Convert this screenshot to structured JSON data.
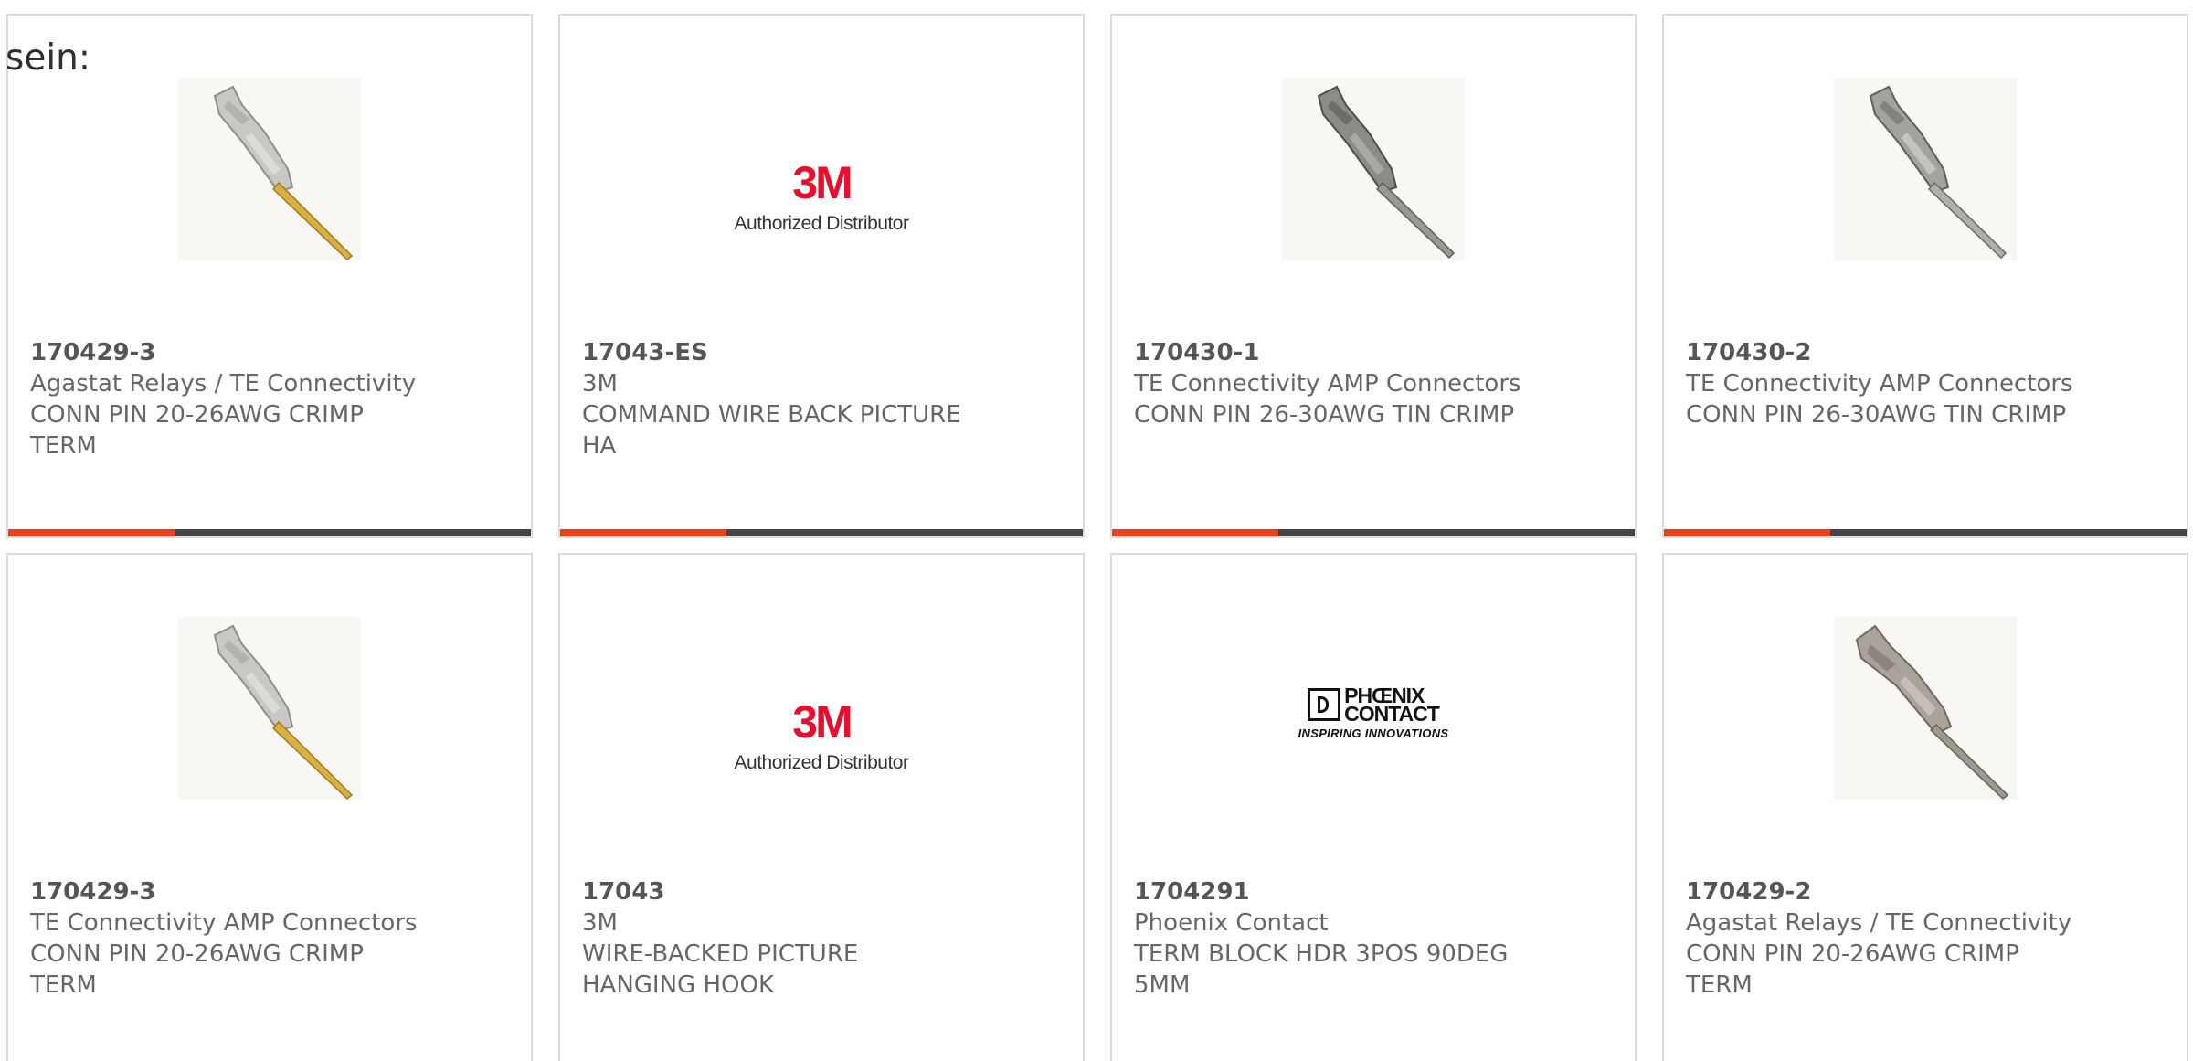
{
  "intro": {
    "text": "sein:"
  },
  "cards": [
    {
      "part_number": "170429-3",
      "manufacturer": "Agastat Relays / TE Connectivity",
      "description_line1": "CONN PIN 20-26AWG CRIMP",
      "description_line2": "TERM",
      "image": "gold-crimp-pin-image"
    },
    {
      "part_number": "17043-ES",
      "manufacturer": "3M",
      "description_line1": "COMMAND WIRE BACK PICTURE",
      "description_line2": "HA",
      "image": "3m-logo",
      "logo_mark": "3M",
      "logo_sub": "Authorized Distributor"
    },
    {
      "part_number": "170430-1",
      "manufacturer": "TE Connectivity AMP Connectors",
      "description_line1": "CONN PIN 26-30AWG TIN CRIMP",
      "description_line2": "",
      "image": "tin-crimp-pin-image"
    },
    {
      "part_number": "170430-2",
      "manufacturer": "TE Connectivity AMP Connectors",
      "description_line1": "CONN PIN 26-30AWG TIN CRIMP",
      "description_line2": "",
      "image": "tin-crimp-pin-image"
    },
    {
      "part_number": "170429-3",
      "manufacturer": "TE Connectivity AMP Connectors",
      "description_line1": "CONN PIN 20-26AWG CRIMP",
      "description_line2": "TERM",
      "image": "gold-crimp-pin-image"
    },
    {
      "part_number": "17043",
      "manufacturer": "3M",
      "description_line1": "WIRE-BACKED PICTURE",
      "description_line2": "HANGING HOOK",
      "image": "3m-logo",
      "logo_mark": "3M",
      "logo_sub": "Authorized Distributor"
    },
    {
      "part_number": "1704291",
      "manufacturer": "Phoenix Contact",
      "description_line1": "TERM BLOCK HDR 3POS 90DEG",
      "description_line2": "5MM",
      "image": "phoenix-contact-logo",
      "logo_line1": "PHŒNIX",
      "logo_line2": "CONTACT",
      "logo_tagline": "INSPIRING INNOVATIONS"
    },
    {
      "part_number": "170429-2",
      "manufacturer": "Agastat Relays / TE Connectivity",
      "description_line1": "CONN PIN 20-26AWG CRIMP",
      "description_line2": "TERM",
      "image": "tin-crimp-pin-image"
    }
  ],
  "colors": {
    "accent": "#e8401c",
    "bar": "#444444",
    "border": "#dcdcdc",
    "text": "#666666",
    "brand_3m": "#e3102f"
  }
}
